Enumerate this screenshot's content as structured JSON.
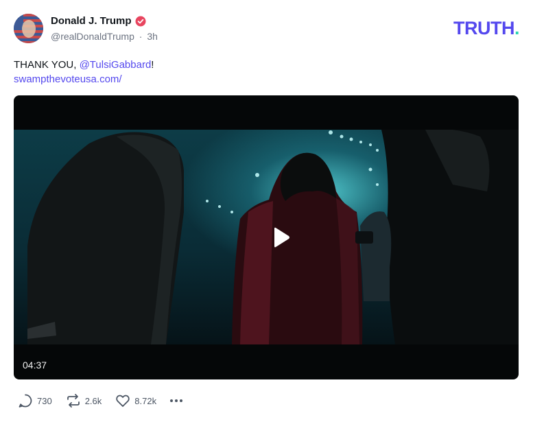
{
  "author": {
    "name": "Donald J. Trump",
    "handle": "@realDonaldTrump",
    "separator": "·",
    "time": "3h",
    "verified_color": "#e8455f"
  },
  "brand": {
    "logo_text": "TRUTH",
    "logo_dot": ".",
    "color": "#5448ee",
    "dot_color": "#2bd5b2"
  },
  "post": {
    "text_prefix": "THANK YOU, ",
    "mention": "@TulsiGabbard",
    "text_suffix": "!",
    "link": "swampthevoteusa.com/"
  },
  "video": {
    "duration": "04:37",
    "play_icon": "play-icon"
  },
  "actions": {
    "replies": "730",
    "retruths": "2.6k",
    "likes": "8.72k",
    "reply_icon": "reply-icon",
    "retruth_icon": "retruth-icon",
    "like_icon": "heart-icon",
    "more_icon": "more-icon"
  }
}
